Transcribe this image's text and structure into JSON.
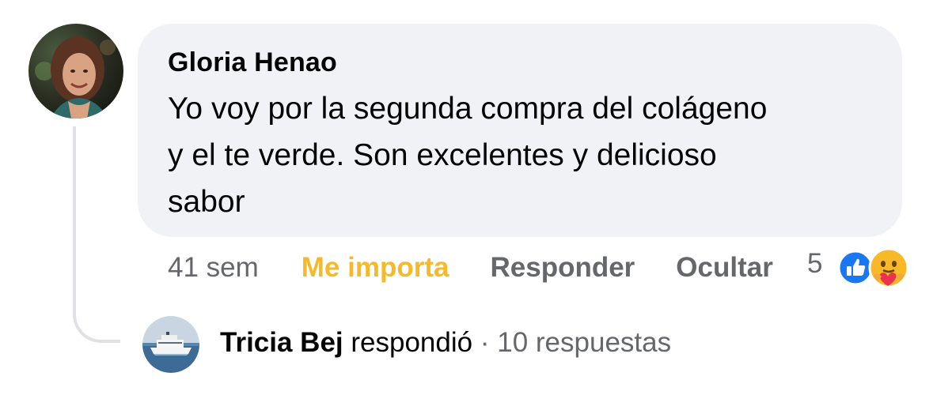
{
  "comment": {
    "author": "Gloria Henao",
    "text_lines": [
      "Yo voy por la segunda compra del colágeno",
      "y el te verde. Son excelentes y delicioso",
      "sabor"
    ],
    "avatar_icon": "profile-photo-woman",
    "actions": {
      "time": "41 sem",
      "reaction_label": "Me importa",
      "reply_label": "Responder",
      "hide_label": "Ocultar"
    },
    "reactions": {
      "count": "5",
      "types": [
        "like-icon",
        "care-icon"
      ]
    }
  },
  "reply_summary": {
    "name": "Tricia Bej",
    "verb": "respondió",
    "separator": "·",
    "count_text": "10 respuestas",
    "avatar_icon": "profile-photo-ship"
  },
  "colors": {
    "bubble_bg": "#f0f2f5",
    "primary_text": "#050505",
    "secondary_text": "#65676b",
    "care_reaction": "#f7b928",
    "like_blue": "#1877f2"
  }
}
